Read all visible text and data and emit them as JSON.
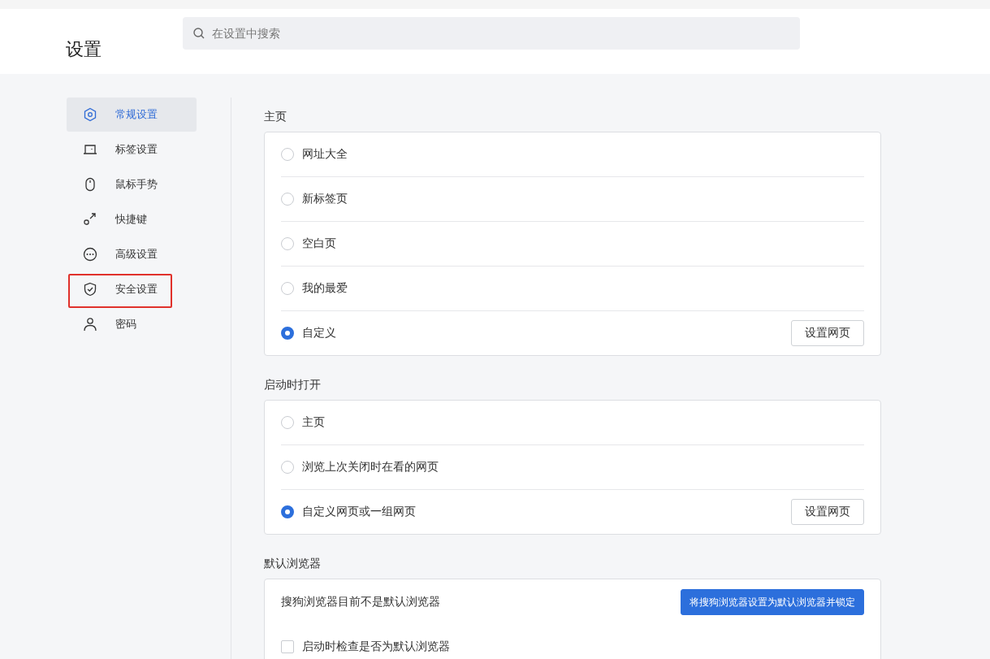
{
  "header": {
    "title": "设置",
    "search": {
      "placeholder": "在设置中搜索"
    }
  },
  "sidebar": {
    "items": [
      {
        "label": "常规设置",
        "selected": true,
        "annotated": false
      },
      {
        "label": "标签设置",
        "selected": false,
        "annotated": false
      },
      {
        "label": "鼠标手势",
        "selected": false,
        "annotated": false
      },
      {
        "label": "快捷键",
        "selected": false,
        "annotated": false
      },
      {
        "label": "高级设置",
        "selected": false,
        "annotated": false
      },
      {
        "label": "安全设置",
        "selected": false,
        "annotated": true
      },
      {
        "label": "密码",
        "selected": false,
        "annotated": false
      }
    ]
  },
  "sections": [
    {
      "title": "主页",
      "rows": [
        {
          "kind": "radio",
          "label": "网址大全",
          "selected": false
        },
        {
          "kind": "radio",
          "label": "新标签页",
          "selected": false
        },
        {
          "kind": "radio",
          "label": "空白页",
          "selected": false
        },
        {
          "kind": "radio",
          "label": "我的最爱",
          "selected": false
        },
        {
          "kind": "radio",
          "label": "自定义",
          "selected": true,
          "button": "设置网页"
        }
      ]
    },
    {
      "title": "启动时打开",
      "rows": [
        {
          "kind": "radio",
          "label": "主页",
          "selected": false
        },
        {
          "kind": "radio",
          "label": "浏览上次关闭时在看的网页",
          "selected": false
        },
        {
          "kind": "radio",
          "label": "自定义网页或一组网页",
          "selected": true,
          "button": "设置网页"
        }
      ]
    },
    {
      "title": "默认浏览器",
      "rows": [
        {
          "kind": "text",
          "label": "搜狗浏览器目前不是默认浏览器",
          "primary_button": "将搜狗浏览器设置为默认浏览器并锁定"
        },
        {
          "kind": "checkbox",
          "label": "启动时检查是否为默认浏览器",
          "checked": false
        }
      ]
    }
  ]
}
